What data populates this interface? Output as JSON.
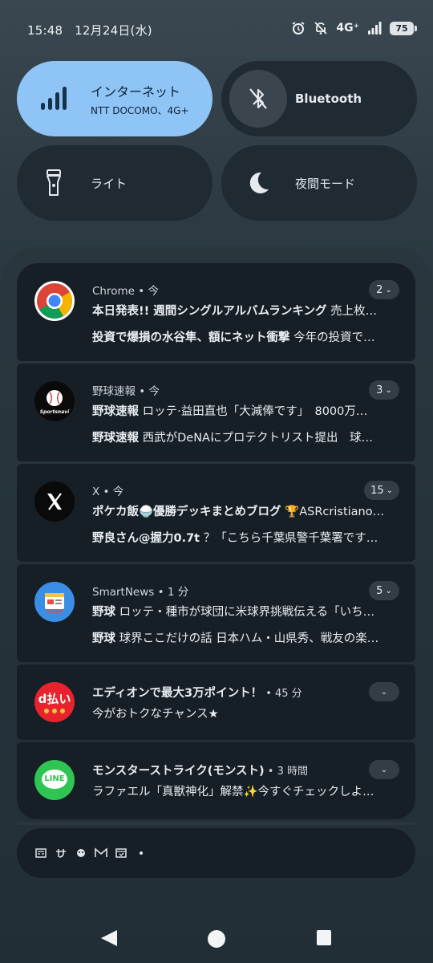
{
  "status": {
    "time": "15:48",
    "date": "12月24日(水)",
    "network": "4G⁺",
    "battery": "75"
  },
  "tiles": [
    {
      "title": "インターネット",
      "subtitle": "NTT DOCOMO、4G+"
    },
    {
      "title": "Bluetooth"
    },
    {
      "title": "ライト"
    },
    {
      "title": "夜間モード"
    }
  ],
  "notifications": [
    {
      "app": "Chrome • 今",
      "count": "2",
      "line1_title": "本日発表!! 週間シングルアルバムランキング",
      "line1_text": " 売上枚…",
      "line2_title": "投資で爆損の水谷隼、額にネット衝撃",
      "line2_text": " 今年の投資で…"
    },
    {
      "app": "野球速報 • 今",
      "count": "3",
      "line1_title": "野球速報",
      "line1_text": " ロッテ·益田直也「大減俸です」　8000万…",
      "line2_title": "野球速報",
      "line2_text": " 西武がDeNAにプロテクトリスト提出　球…"
    },
    {
      "app": "X • 今",
      "count": "15",
      "line1_title": "ポケカ飯🍚優勝デッキまとめブログ",
      "line1_text": " 🏆ASRcristiano…",
      "line2_title": "野良さん@握力0.7t",
      "line2_text": " ？「こちら千葉県警千葉署です…"
    },
    {
      "app": "SmartNews • 1 分",
      "count": "5",
      "line1_title": "野球",
      "line1_text": " ロッテ・種市が球団に米球界挑戦伝える「いち…",
      "line2_title": "野球",
      "line2_text": " 球界ここだけの話 日本ハム・山県秀、戦友の楽…"
    },
    {
      "app_title": "エディオンで最大3万ポイント！",
      "time": " • 45 分",
      "text": "今がおトクなチャンス★"
    },
    {
      "app_title": "モンスターストライク(モンスト)",
      "time": " • 3 時間",
      "text": "ラファエル「真獣神化」解禁✨今すぐチェックしよ…"
    }
  ],
  "icons": {
    "chrome": "chrome-icon",
    "sportsnavi": "sportsnavi-icon",
    "x": "x-icon",
    "smartnews": "smartnews-icon",
    "dpay": "d-barai-icon",
    "line": "line-icon"
  },
  "dpay_label": "d払い",
  "sportsnavi_label": "Sportsnavi",
  "line_label": "LINE"
}
